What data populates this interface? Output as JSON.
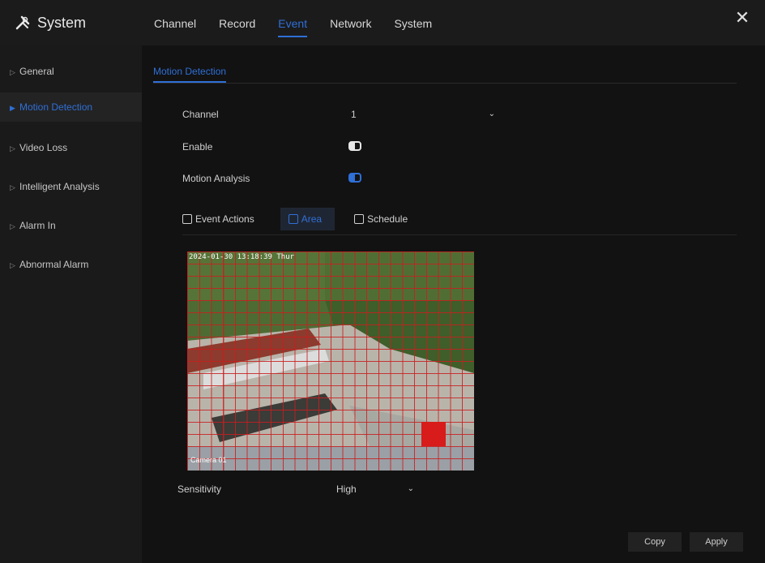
{
  "window": {
    "title": "System",
    "close_glyph": "✕"
  },
  "top_tabs": [
    {
      "label": "Channel",
      "active": false
    },
    {
      "label": "Record",
      "active": false
    },
    {
      "label": "Event",
      "active": true
    },
    {
      "label": "Network",
      "active": false
    },
    {
      "label": "System",
      "active": false
    }
  ],
  "sidebar": {
    "items": [
      {
        "label": "General",
        "active": false
      },
      {
        "label": "Motion Detection",
        "active": true
      },
      {
        "label": "Video Loss",
        "active": false
      },
      {
        "label": "Intelligent Analysis",
        "active": false
      },
      {
        "label": "Alarm In",
        "active": false
      },
      {
        "label": "Abnormal Alarm",
        "active": false
      }
    ]
  },
  "main": {
    "subtab": "Motion Detection",
    "form": {
      "channel_label": "Channel",
      "channel_value": "1",
      "enable_label": "Enable",
      "motion_analysis_label": "Motion Analysis"
    },
    "actions": {
      "event_actions": "Event Actions",
      "area": "Area",
      "schedule": "Schedule"
    },
    "video": {
      "timestamp": "2024-01-30 13:18:39 Thur",
      "channel_name": "Camera 01"
    },
    "sensitivity": {
      "label": "Sensitivity",
      "value": "High"
    },
    "buttons": {
      "copy": "Copy",
      "apply": "Apply"
    }
  },
  "colors": {
    "accent": "#2f6fd6",
    "grid": "#c81e1e",
    "background": "#141414"
  }
}
